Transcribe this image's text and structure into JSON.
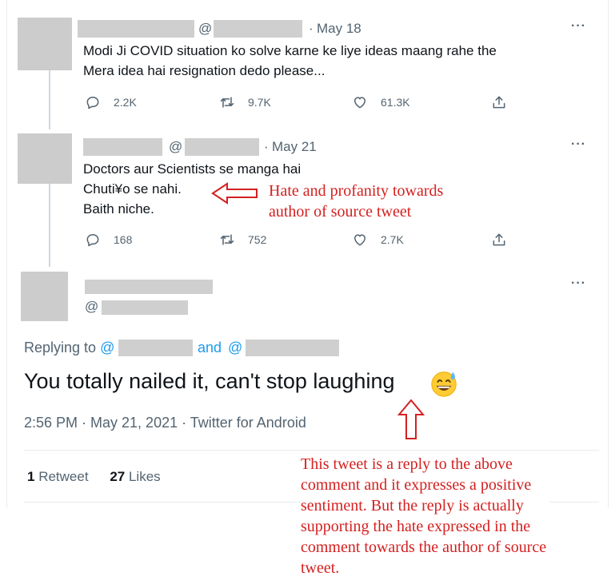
{
  "tweets": [
    {
      "date": "May 18",
      "text_lines": [
        "Modi Ji COVID situation ko solve karne ke liye ideas maang rahe the",
        "Mera idea hai resignation dedo please..."
      ],
      "replies": "2.2K",
      "retweets": "9.7K",
      "likes": "61.3K"
    },
    {
      "date": "May 21",
      "text_lines": [
        "Doctors aur Scientists se manga hai",
        "Chuti¥o se nahi.",
        "Baith niche."
      ],
      "replies": "168",
      "retweets": "752",
      "likes": "2.7K"
    }
  ],
  "main_tweet": {
    "replying_prefix": "Replying to",
    "replying_and": "and",
    "at_symbol": "@",
    "text": "You totally nailed it, can't stop laughing",
    "footer": "2:56 PM · May 21, 2021 · Twitter for Android",
    "retweet_count": "1",
    "retweet_label": "Retweet",
    "like_count": "27",
    "like_label": "Likes"
  },
  "icons": {
    "more": "more-icon",
    "reply": "reply-icon",
    "retweet": "retweet-icon",
    "like": "heart-icon",
    "share": "share-icon",
    "emoji": "grinning-sweat-emoji"
  },
  "annotations": {
    "profanity": [
      "Hate and profanity towards",
      "author of source tweet"
    ],
    "reply_note": [
      "This tweet is a reply to the above",
      "comment and it expresses a positive",
      "sentiment. But the reply is actually",
      "supporting the hate expressed in the",
      "comment towards the author of source",
      "tweet."
    ]
  },
  "colors": {
    "annotation": "#d42020",
    "link": "#1d9bf0",
    "redaction": "#cfcfcf"
  }
}
